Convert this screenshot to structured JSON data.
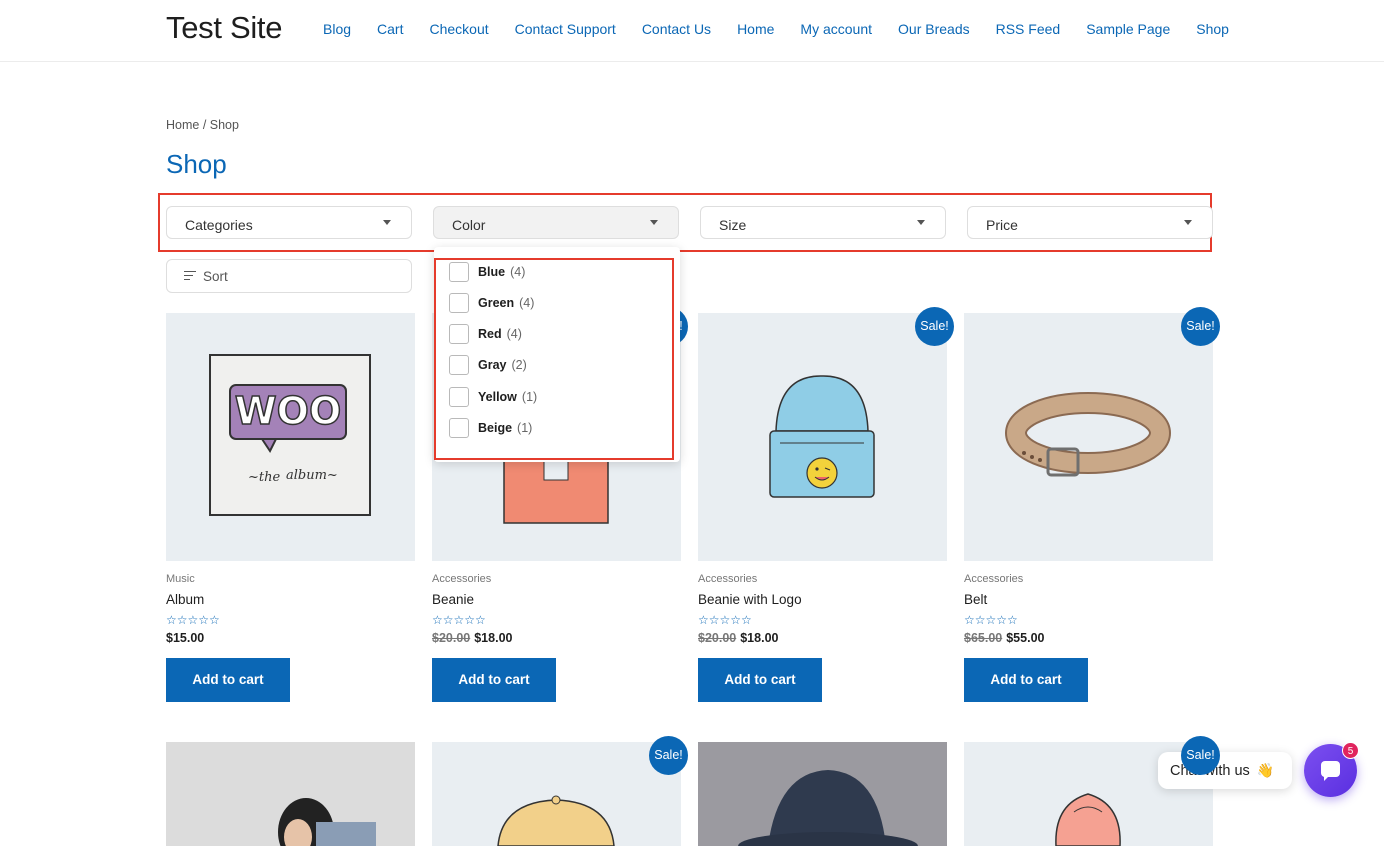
{
  "site": {
    "title": "Test Site"
  },
  "nav": [
    "Blog",
    "Cart",
    "Checkout",
    "Contact Support",
    "Contact Us",
    "Home",
    "My account",
    "Our Breads",
    "RSS Feed",
    "Sample Page",
    "Shop"
  ],
  "breadcrumb": "Home / Shop",
  "page_title": "Shop",
  "filters": {
    "categories": "Categories",
    "color": "Color",
    "size": "Size",
    "price": "Price"
  },
  "sort_label": "Sort",
  "color_options": [
    {
      "name": "Blue",
      "count": "(4)"
    },
    {
      "name": "Green",
      "count": "(4)"
    },
    {
      "name": "Red",
      "count": "(4)"
    },
    {
      "name": "Gray",
      "count": "(2)"
    },
    {
      "name": "Yellow",
      "count": "(1)"
    },
    {
      "name": "Beige",
      "count": "(1)"
    }
  ],
  "products": [
    {
      "category": "Music",
      "title": "Album",
      "old_price": "",
      "price": "$15.00",
      "button": "Add to cart",
      "rating": 0
    },
    {
      "category": "Accessories",
      "title": "Beanie",
      "old_price": "$20.00",
      "price": "$18.00",
      "button": "Add to cart",
      "rating": 0
    },
    {
      "category": "Accessories",
      "title": "Beanie with Logo",
      "old_price": "$20.00",
      "price": "$18.00",
      "button": "Add to cart",
      "rating": 0
    },
    {
      "category": "Accessories",
      "title": "Belt",
      "old_price": "$65.00",
      "price": "$55.00",
      "button": "Add to cart",
      "rating": 0
    }
  ],
  "sale_badge": "Sale!",
  "stars": "☆☆☆☆☆",
  "chat": {
    "label": "Chat with us",
    "emoji": "👋",
    "badge": "5"
  },
  "colors": {
    "accent": "#0b67b5",
    "highlight": "#e53b2c",
    "chat": "#6a3ff0",
    "badge": "#e0245e"
  }
}
